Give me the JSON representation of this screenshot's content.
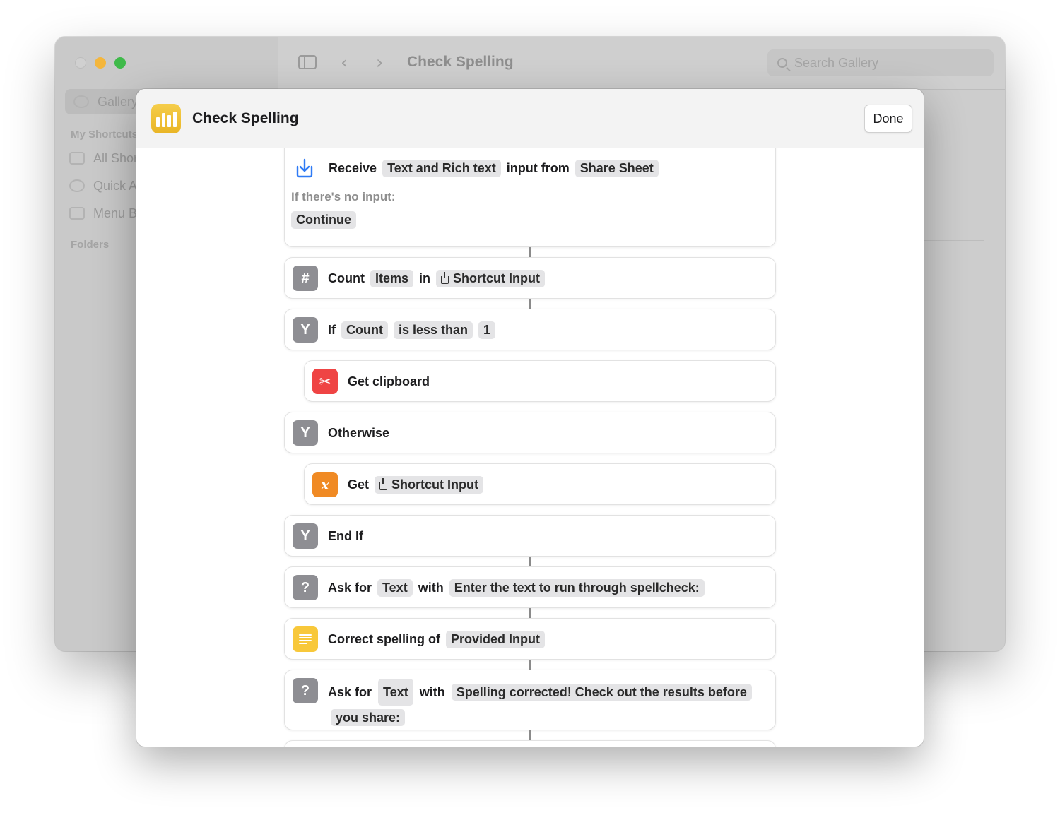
{
  "window": {
    "title": "Check Spelling",
    "search_placeholder": "Search Gallery"
  },
  "sidebar": {
    "gallery": "Gallery",
    "section_my_shortcuts": "My Shortcuts",
    "all_shortcuts": "All Shortcuts",
    "quick_actions": "Quick Actions",
    "menu_bar": "Menu Bar",
    "section_folders": "Folders"
  },
  "sheet": {
    "title": "Check Spelling",
    "done_label": "Done"
  },
  "actions": {
    "receive": {
      "label": "Receive",
      "types": "Text and Rich text",
      "mid": "input from",
      "source": "Share Sheet",
      "no_input_label": "If there's no input:",
      "no_input_action": "Continue"
    },
    "count": {
      "label": "Count",
      "what": "Items",
      "mid": "in",
      "target": "Shortcut Input"
    },
    "if": {
      "label": "If",
      "var": "Count",
      "cond": "is less than",
      "value": "1"
    },
    "clipboard": {
      "label": "Get clipboard"
    },
    "otherwise": {
      "label": "Otherwise"
    },
    "get": {
      "label": "Get",
      "target": "Shortcut Input"
    },
    "endif": {
      "label": "End If"
    },
    "ask1": {
      "label": "Ask for",
      "type": "Text",
      "mid": "with",
      "prompt": "Enter the text to run through spellcheck:"
    },
    "correct": {
      "label": "Correct spelling of",
      "target": "Provided Input"
    },
    "ask2": {
      "label": "Ask for",
      "type": "Text",
      "mid": "with",
      "prompt": "Spelling corrected! Check out the results before you share:"
    }
  },
  "colors": {
    "gray_action": "#8e8e93",
    "red_action": "#ef4444",
    "orange_action": "#f08a24",
    "yellow_action": "#f8c83a",
    "link_blue": "#2f7bf5"
  }
}
